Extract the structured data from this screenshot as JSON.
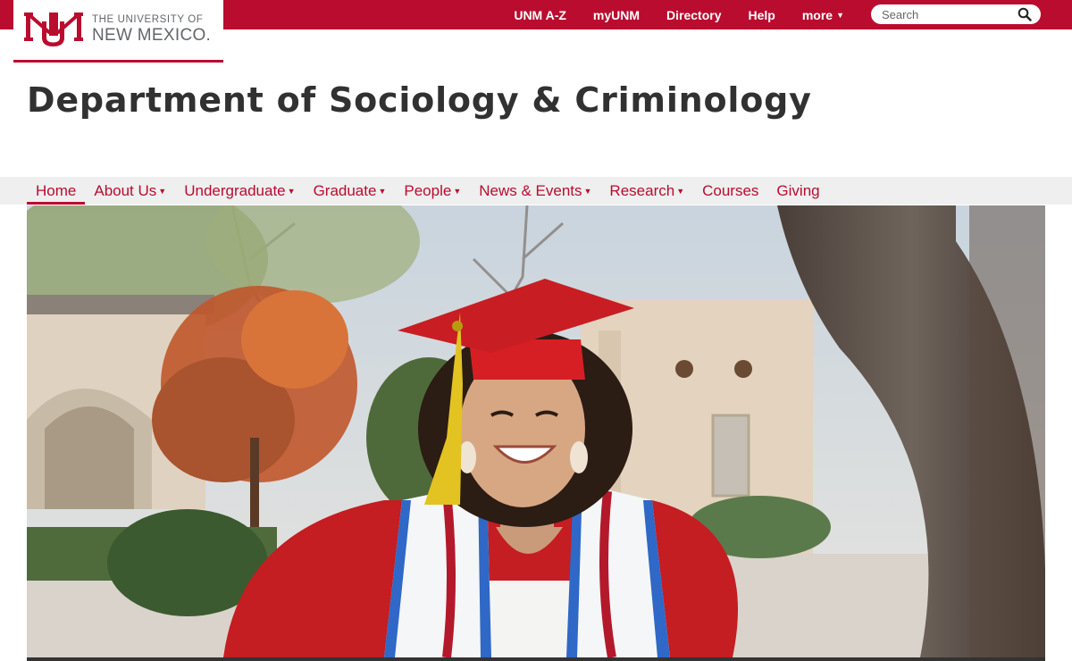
{
  "header": {
    "top_links": [
      {
        "label": "UNM A-Z",
        "has_caret": false
      },
      {
        "label": "myUNM",
        "has_caret": false
      },
      {
        "label": "Directory",
        "has_caret": false
      },
      {
        "label": "Help",
        "has_caret": false
      },
      {
        "label": "more",
        "has_caret": true
      }
    ],
    "search": {
      "placeholder": "Search"
    },
    "logo": {
      "line1": "THE UNIVERSITY OF",
      "line2": "NEW MEXICO."
    }
  },
  "page": {
    "title": "Department of Sociology & Criminology"
  },
  "nav": {
    "items": [
      {
        "label": "Home",
        "active": true,
        "dropdown": false
      },
      {
        "label": "About Us",
        "dropdown": true
      },
      {
        "label": "Undergraduate",
        "dropdown": true
      },
      {
        "label": "Graduate",
        "dropdown": true
      },
      {
        "label": "People",
        "dropdown": true
      },
      {
        "label": "News & Events",
        "dropdown": true
      },
      {
        "label": "Research",
        "dropdown": true
      },
      {
        "label": "Courses",
        "dropdown": false
      },
      {
        "label": "Giving",
        "dropdown": false
      }
    ]
  },
  "hero": {
    "image_subject": "graduate-in-red-cap-and-gown"
  },
  "colors": {
    "brand_red": "#ba0c2f",
    "title_gray": "#313131",
    "nav_bg": "#efefef"
  }
}
